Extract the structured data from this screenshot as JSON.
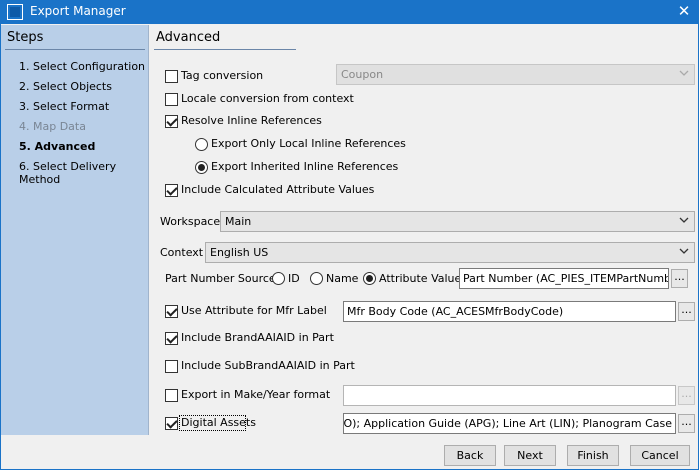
{
  "window": {
    "title": "Export Manager",
    "close_symbol": "✕"
  },
  "steps": {
    "title": "Steps",
    "items": [
      {
        "label": "1. Select Configuration",
        "state": "normal"
      },
      {
        "label": "2. Select Objects",
        "state": "normal"
      },
      {
        "label": "3. Select Format",
        "state": "normal"
      },
      {
        "label": "4. Map Data",
        "state": "disabled"
      },
      {
        "label": "5. Advanced",
        "state": "active"
      },
      {
        "label": "6. Select Delivery Method",
        "state": "normal"
      }
    ]
  },
  "advanced": {
    "title": "Advanced",
    "tag_conversion": {
      "label": "Tag conversion",
      "checked": false,
      "select_value": "Coupon"
    },
    "locale_conversion": {
      "label": "Locale conversion from context",
      "checked": false
    },
    "resolve_inline": {
      "label": "Resolve Inline References",
      "checked": true
    },
    "radio_local": {
      "label": "Export Only Local Inline References",
      "checked": false
    },
    "radio_inherited": {
      "label": "Export Inherited Inline References",
      "checked": true
    },
    "include_calculated": {
      "label": "Include Calculated Attribute Values",
      "checked": true
    },
    "workspace": {
      "label": "Workspace",
      "value": "Main"
    },
    "context": {
      "label": "Context",
      "value": "English US"
    },
    "part_number_source": {
      "label": "Part Number Source",
      "options": [
        "ID",
        "Name",
        "Attribute Value"
      ],
      "selected": "Attribute Value",
      "value": "Part Number (AC_PIES_ITEMPartNumber)"
    },
    "use_attr_mfr": {
      "label": "Use Attribute for Mfr Label",
      "checked": true,
      "value": "Mfr Body Code (AC_ACESMfrBodyCode)"
    },
    "include_brand": {
      "label": "Include BrandAAIAID in Part",
      "checked": true
    },
    "include_subbrand": {
      "label": "Include SubBrandAAIAID in Part",
      "checked": false
    },
    "export_make_year": {
      "label": "Export in Make/Year format",
      "checked": false,
      "value": ""
    },
    "digital_assets": {
      "label": "Digital Assets",
      "checked": true,
      "value": "iure (BRO); Application Guide (APG); Line Art (LIN); Planogram Case"
    },
    "ellipsis": "..."
  },
  "footer": {
    "back": "Back",
    "next": "Next",
    "finish": "Finish",
    "cancel": "Cancel"
  },
  "colors": {
    "title_bar": "#1a73c8",
    "steps_panel": "#b9cfe8"
  }
}
